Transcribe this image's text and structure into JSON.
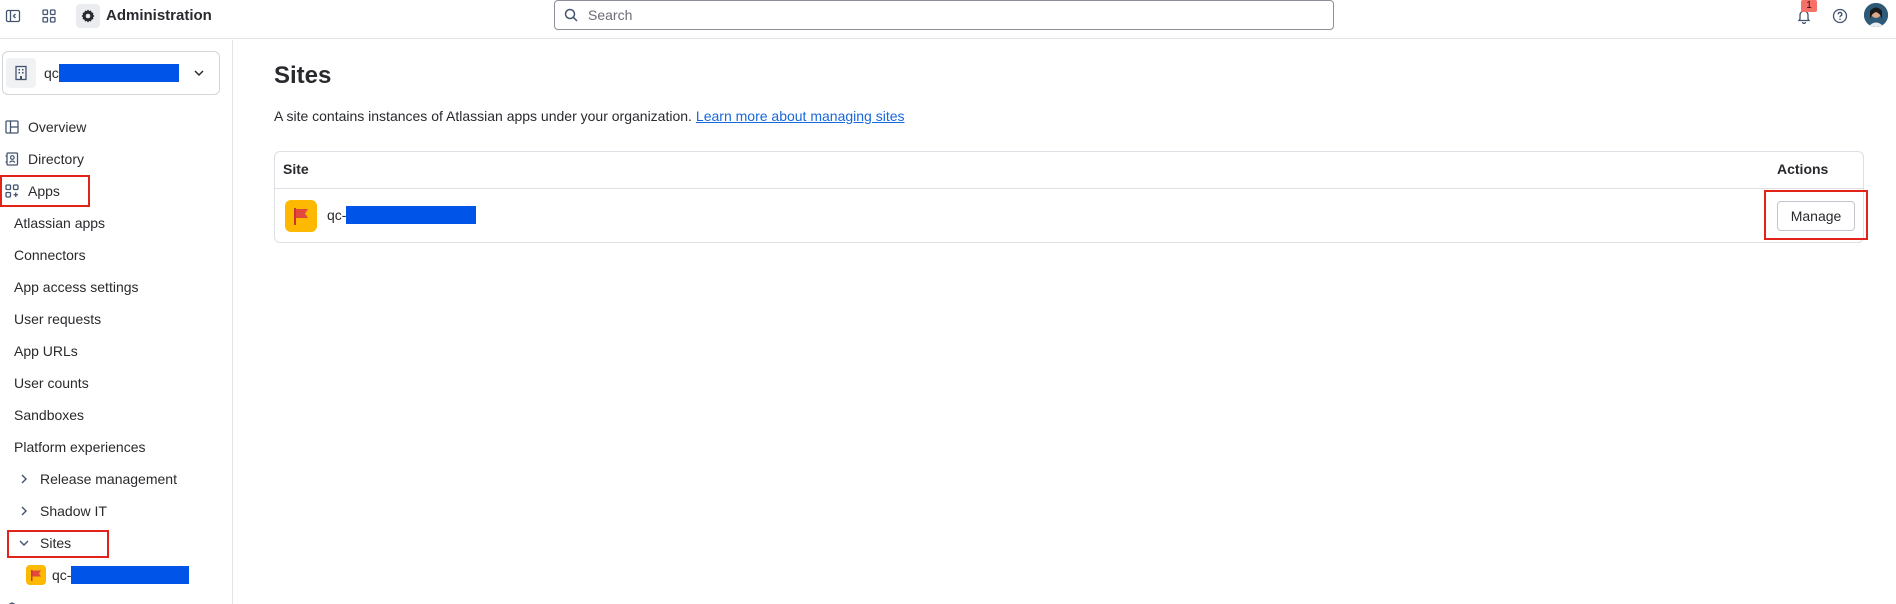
{
  "topbar": {
    "app_title": "Administration",
    "search_placeholder": "Search",
    "notification_count": "1"
  },
  "sidebar": {
    "org_name": "qc",
    "items": [
      {
        "label": "Overview",
        "icon": "overview-icon"
      },
      {
        "label": "Directory",
        "icon": "directory-icon"
      },
      {
        "label": "Apps",
        "icon": "apps-icon"
      }
    ],
    "apps_children": [
      "Atlassian apps",
      "Connectors",
      "App access settings",
      "User requests",
      "App URLs",
      "User counts",
      "Sandboxes",
      "Platform experiences"
    ],
    "expanders": [
      {
        "label": "Release management",
        "expanded": false
      },
      {
        "label": "Shadow IT",
        "expanded": false
      },
      {
        "label": "Sites",
        "expanded": true
      }
    ],
    "site_child": "qc-"
  },
  "main": {
    "title": "Sites",
    "description": "A site contains instances of Atlassian apps under your organization.",
    "learn_more": "Learn more about managing sites",
    "table": {
      "columns": [
        "Site",
        "Actions"
      ],
      "rows": [
        {
          "site": "qc-",
          "action": "Manage"
        }
      ]
    }
  },
  "colors": {
    "highlight": "#e2231a",
    "redaction": "#0055e8",
    "link": "#1868db",
    "site_logo": "#fcb900"
  }
}
